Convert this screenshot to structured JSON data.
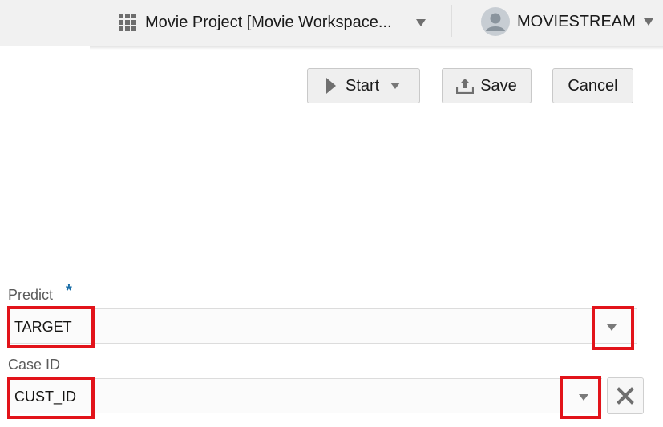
{
  "header": {
    "project_name": "Movie Project [Movie Workspace...",
    "user_name": "MOVIESTREAM"
  },
  "toolbar": {
    "start_label": "Start",
    "save_label": "Save",
    "cancel_label": "Cancel"
  },
  "form": {
    "predict": {
      "label": "Predict",
      "required_marker": "*",
      "value": "TARGET"
    },
    "case_id": {
      "label": "Case ID",
      "value": "CUST_ID"
    }
  },
  "icons": {
    "project": "grid-icon",
    "user": "avatar-icon",
    "start": "play-icon",
    "save": "upload-icon",
    "clear": "close-icon"
  },
  "colors": {
    "highlight": "#e2131a",
    "required": "#1a6ea8",
    "header_bg": "#f1f1f1"
  }
}
